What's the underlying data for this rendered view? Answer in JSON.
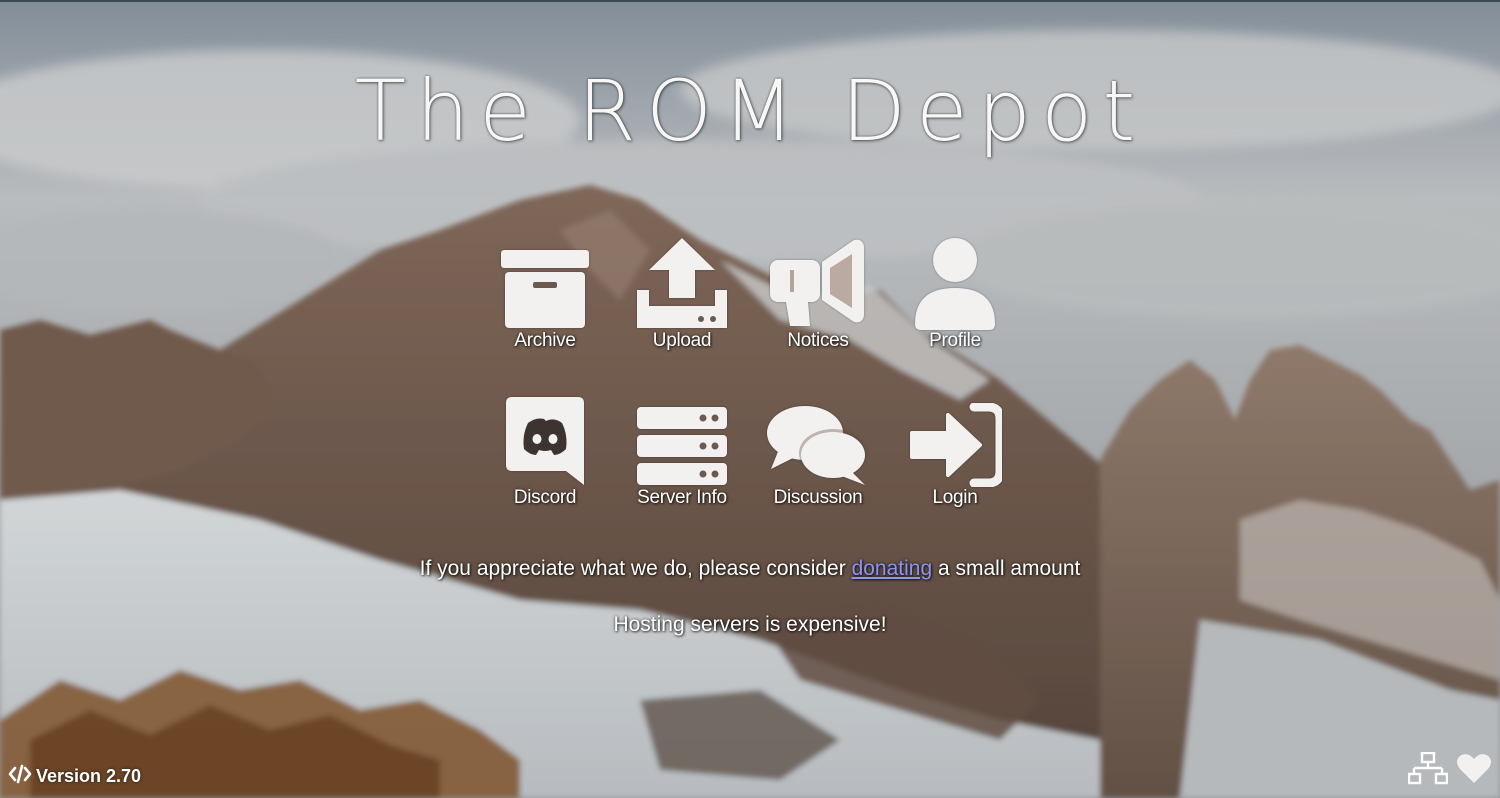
{
  "site": {
    "title": "The ROM Depot"
  },
  "menu": {
    "row1": [
      {
        "label": "Archive",
        "icon": "archive-box-icon"
      },
      {
        "label": "Upload",
        "icon": "upload-icon"
      },
      {
        "label": "Notices",
        "icon": "megaphone-icon"
      },
      {
        "label": "Profile",
        "icon": "user-icon"
      }
    ],
    "row2": [
      {
        "label": "Discord",
        "icon": "discord-icon"
      },
      {
        "label": "Server Info",
        "icon": "server-icon"
      },
      {
        "label": "Discussion",
        "icon": "comments-icon"
      },
      {
        "label": "Login",
        "icon": "sign-in-icon"
      }
    ]
  },
  "donate": {
    "before": "If you appreciate what we do, please consider ",
    "link": "donating",
    "after": " a small amount"
  },
  "hosting_note": "Hosting servers is expensive!",
  "footer": {
    "version_label": "Version 2.70",
    "code_icon": "code-icon",
    "network_icon": "network-icon",
    "heart_icon": "heart-icon"
  },
  "colors": {
    "link": "#8c94f4",
    "text": "#ffffff"
  }
}
